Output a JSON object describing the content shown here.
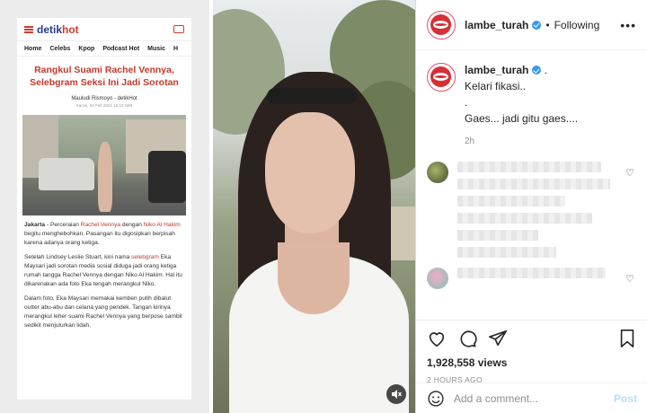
{
  "article": {
    "brand_prefix": "detik",
    "brand_suffix": "hot",
    "nav": [
      "Home",
      "Celebs",
      "Kpop",
      "Podcast Hot",
      "Music",
      "H"
    ],
    "title": "Rangkul Suami Rachel Vennya, Selebgram Seksi Ini Jadi Sorotan",
    "author": "Mauludi Rismoyo - detikHot",
    "date": "Kamis, 04 Feb 2021 18:10 WIB",
    "p1_lead": "Jakarta",
    "p1_a": " - Perceraian ",
    "p1_link1": "Rachel Vennya",
    "p1_b": " dengan ",
    "p1_link2": "Niko Al Hakim",
    "p1_c": " begitu menghebohkan. Pasangan itu digosipkan berpisah karena adanya orang ketiga.",
    "p2_a": "Setelah Lindsey Leslie Stuart, kini nama ",
    "p2_link": "selebgram",
    "p2_b": " Eka Maysari jadi sorotan media sosial diduga jadi orang ketiga rumah tangga Rachel Vennya dengan Niko Al Hakim. Hal itu dikarenakan ada foto Eka tengah merangkul Niko.",
    "p3": "Dalam foto, Eka Maysari memakai kemben putih dibalut outter abu-abu dan celana yang pendek. Tangan kirinya merangkul leher suami Rachel Vennya yang berpose sambil sedikit menjulurkan lidah."
  },
  "post": {
    "username": "lambe_turah",
    "follow_state": "Following",
    "dot": "•",
    "more": "•••",
    "caption_line1": "Kelari fikasi..",
    "caption_line2": ".",
    "caption_line3": "Gaes... jadi gitu gaes....",
    "caption_dot": ".",
    "time": "2h",
    "views": "1,928,558 views",
    "time_ago": "2 HOURS AGO",
    "comment_placeholder": "Add a comment...",
    "post_label": "Post"
  },
  "colors": {
    "brand_red": "#d23b2c",
    "verified_blue": "#3897f0",
    "post_button": "#b2dffc"
  }
}
